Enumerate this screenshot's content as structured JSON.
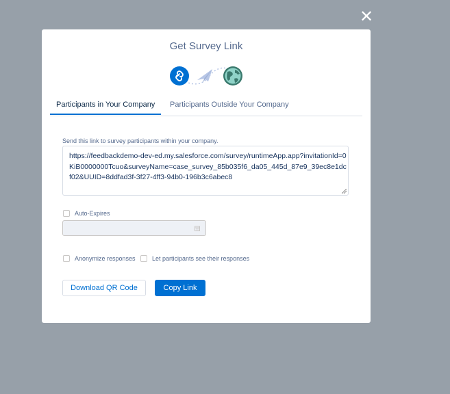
{
  "close": {
    "glyph": "✕"
  },
  "modal": {
    "title": "Get Survey Link",
    "tabs": [
      {
        "label": "Participants in Your Company",
        "active": true
      },
      {
        "label": "Participants Outside Your Company",
        "active": false
      }
    ],
    "help_text": "Send this link to survey participants within your company.",
    "link": "https://feedbackdemo-dev-ed.my.salesforce.com/survey/runtimeApp.app?invitationId=0KiB0000000Tcuo&surveyName=case_survey_85b035f6_da05_445d_87e9_39ec8e1dcf02&UUID=8ddfad3f-3f27-4ff3-94b0-196b3c6abec8",
    "auto_expires_label": "Auto-Expires",
    "auto_expires_checked": false,
    "anonymize_label": "Anonymize responses",
    "anonymize_checked": false,
    "see_responses_label": "Let participants see their responses",
    "see_responses_checked": false,
    "qr_button_label": "Download QR Code",
    "copy_button_label": "Copy Link",
    "icons": [
      "link-icon",
      "paper-plane-icon",
      "globe-icon",
      "calendar-icon"
    ]
  },
  "colors": {
    "overlay": "#97a0a9",
    "brand": "#0070d2",
    "title_text": "#54698d",
    "link_text": "#16325c",
    "globe": "#3b7a6e"
  }
}
